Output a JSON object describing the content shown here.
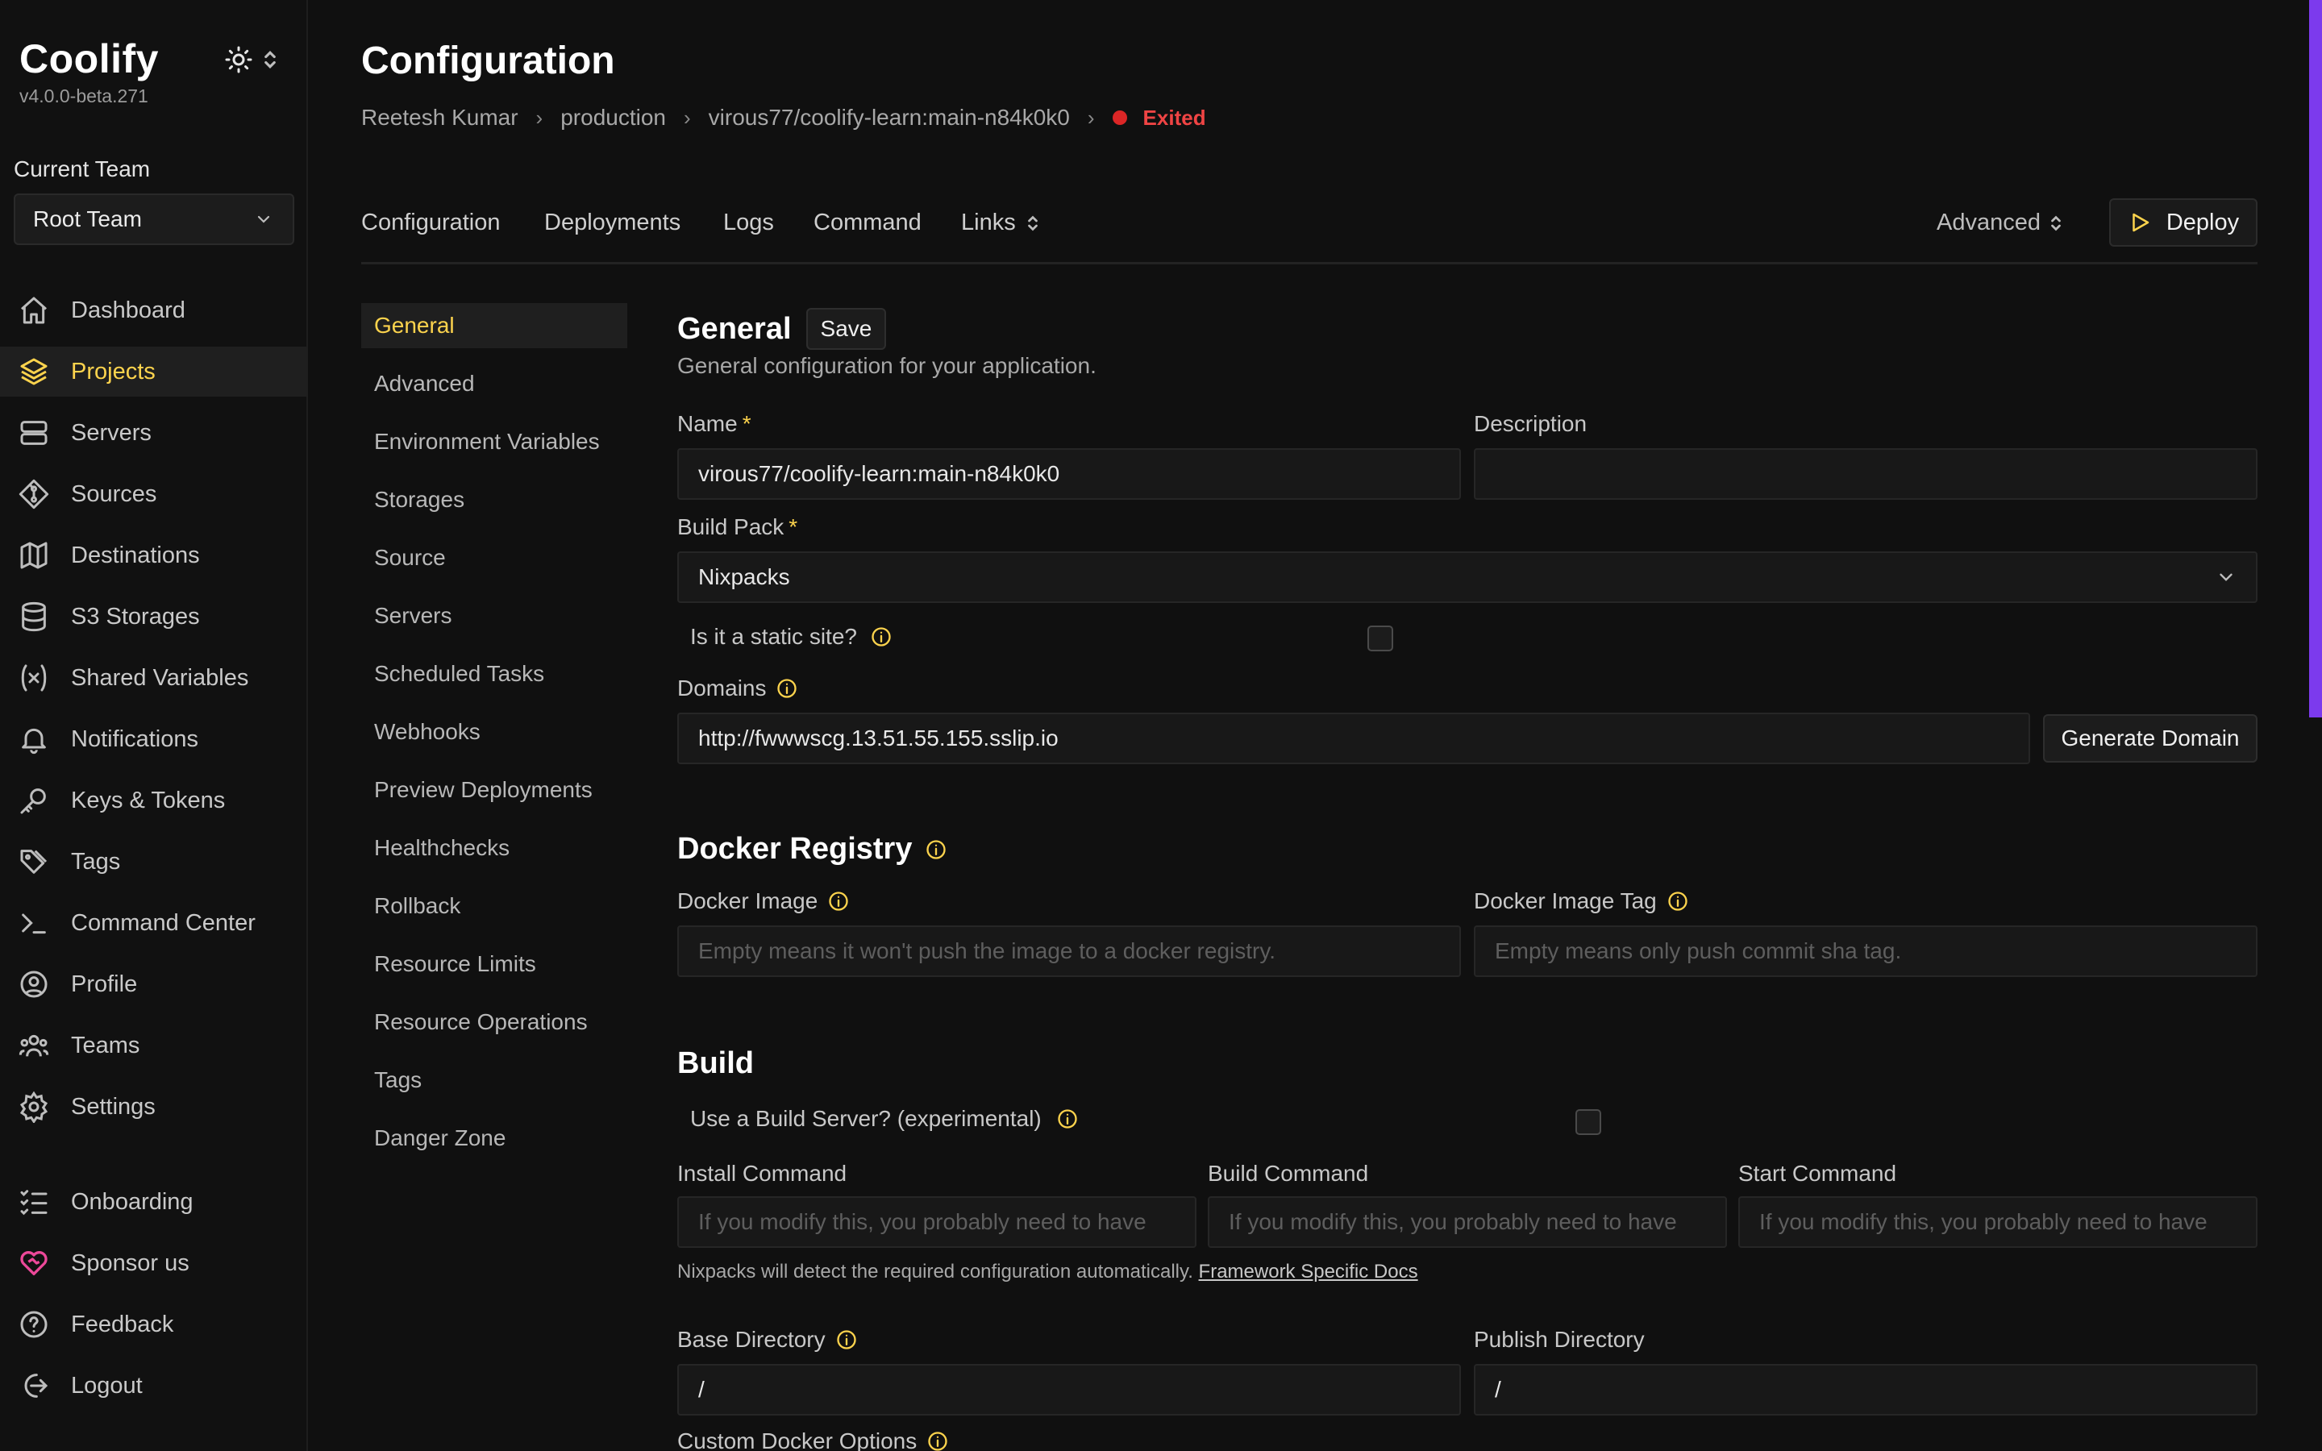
{
  "app": {
    "name": "Coolify",
    "version": "v4.0.0-beta.271"
  },
  "team": {
    "label": "Current Team",
    "selected": "Root Team"
  },
  "sidebar": {
    "items": [
      {
        "label": "Dashboard",
        "icon": "home-icon"
      },
      {
        "label": "Projects",
        "icon": "layers-icon",
        "active": true
      },
      {
        "label": "Servers",
        "icon": "server-icon"
      },
      {
        "label": "Sources",
        "icon": "git-icon"
      },
      {
        "label": "Destinations",
        "icon": "map-icon"
      },
      {
        "label": "S3 Storages",
        "icon": "database-icon"
      },
      {
        "label": "Shared Variables",
        "icon": "variable-icon"
      },
      {
        "label": "Notifications",
        "icon": "bell-icon"
      },
      {
        "label": "Keys & Tokens",
        "icon": "key-icon"
      },
      {
        "label": "Tags",
        "icon": "tags-icon"
      },
      {
        "label": "Command Center",
        "icon": "terminal-icon"
      },
      {
        "label": "Profile",
        "icon": "user-circle-icon"
      },
      {
        "label": "Teams",
        "icon": "users-icon"
      },
      {
        "label": "Settings",
        "icon": "gear-icon"
      }
    ],
    "bottom": [
      {
        "label": "Onboarding",
        "icon": "list-check-icon"
      },
      {
        "label": "Sponsor us",
        "icon": "heart-handshake-icon"
      },
      {
        "label": "Feedback",
        "icon": "help-circle-icon"
      },
      {
        "label": "Logout",
        "icon": "logout-icon"
      }
    ]
  },
  "page": {
    "title": "Configuration",
    "breadcrumb": [
      "Reetesh Kumar",
      "production",
      "virous77/coolify-learn:main-n84k0k0"
    ],
    "status": "Exited",
    "status_color": "#ef4444"
  },
  "tabs": [
    "Configuration",
    "Deployments",
    "Logs",
    "Command",
    "Links"
  ],
  "advanced_label": "Advanced",
  "deploy_label": "Deploy",
  "subnav": [
    "General",
    "Advanced",
    "Environment Variables",
    "Storages",
    "Source",
    "Servers",
    "Scheduled Tasks",
    "Webhooks",
    "Preview Deployments",
    "Healthchecks",
    "Rollback",
    "Resource Limits",
    "Resource Operations",
    "Tags",
    "Danger Zone"
  ],
  "general": {
    "title": "General",
    "save_label": "Save",
    "subtitle": "General configuration for your application.",
    "name_label": "Name",
    "name_value": "virous77/coolify-learn:main-n84k0k0",
    "description_label": "Description",
    "description_value": "",
    "buildpack_label": "Build Pack",
    "buildpack_value": "Nixpacks",
    "static_label": "Is it a static site?",
    "domains_label": "Domains",
    "domains_value": "http://fwwwscg.13.51.55.155.sslip.io",
    "generate_domain_label": "Generate Domain"
  },
  "registry": {
    "title": "Docker Registry",
    "image_label": "Docker Image",
    "image_placeholder": "Empty means it won't push the image to a docker registry.",
    "tag_label": "Docker Image Tag",
    "tag_placeholder": "Empty means only push commit sha tag."
  },
  "build": {
    "title": "Build",
    "build_server_label": "Use a Build Server? (experimental)",
    "install_label": "Install Command",
    "build_label": "Build Command",
    "start_label": "Start Command",
    "cmd_placeholder": "If you modify this, you probably need to have",
    "helper_text": "Nixpacks will detect the required configuration automatically.",
    "helper_link": "Framework Specific Docs",
    "base_dir_label": "Base Directory",
    "base_dir_value": "/",
    "publish_dir_label": "Publish Directory",
    "publish_dir_value": "/",
    "custom_docker_label": "Custom Docker Options"
  },
  "colors": {
    "accent": "#fcd34d",
    "scrollbar": "#7c3aed",
    "background": "#101010"
  }
}
